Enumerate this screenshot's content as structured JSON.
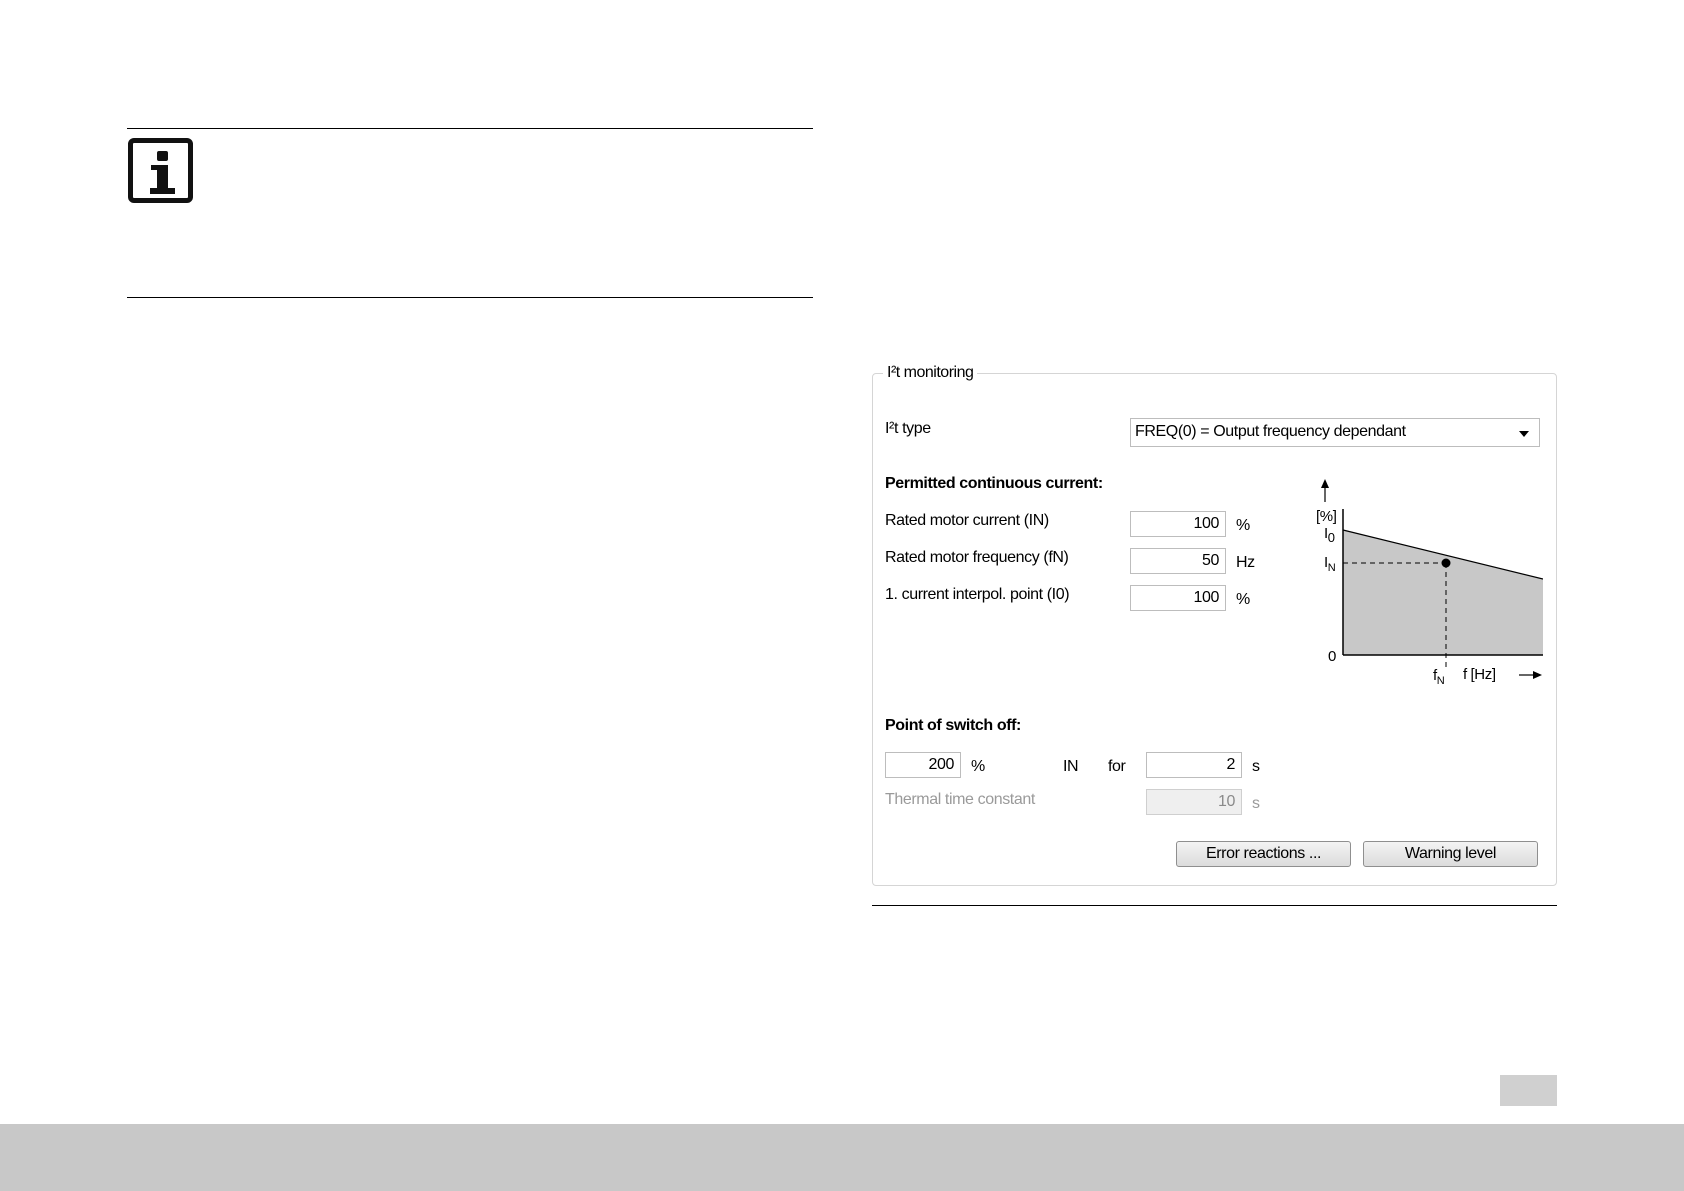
{
  "dialog": {
    "legend": "I²t monitoring",
    "type_label": "I²t type",
    "type_value": "FREQ(0) = Output frequency dependant",
    "section_current": "Permitted continuous current:",
    "rated_current_label": "Rated motor current (IN)",
    "rated_current_value": "100",
    "rated_current_unit": "%",
    "rated_freq_label": "Rated motor frequency (fN)",
    "rated_freq_value": "50",
    "rated_freq_unit": "Hz",
    "interpol_label": "1. current interpol. point (I0)",
    "interpol_value": "100",
    "interpol_unit": "%",
    "section_switch_off": "Point of switch off:",
    "switch_value": "200",
    "switch_unit": "%",
    "in_label": "IN",
    "for_label": "for",
    "time_value": "2",
    "time_unit": "s",
    "thermal_label": "Thermal time constant",
    "thermal_value": "10",
    "thermal_unit": "s",
    "error_button": "Error reactions ...",
    "warning_button": "Warning level"
  },
  "graph": {
    "y_unit": "[%]",
    "i0_label": "I",
    "i0_sub": "0",
    "in_label": "I",
    "in_sub": "N",
    "zero_label": "0",
    "fn_label": "f",
    "fn_sub": "N",
    "x_label": "f [Hz]",
    "fill_color": "#c8c8c8"
  }
}
